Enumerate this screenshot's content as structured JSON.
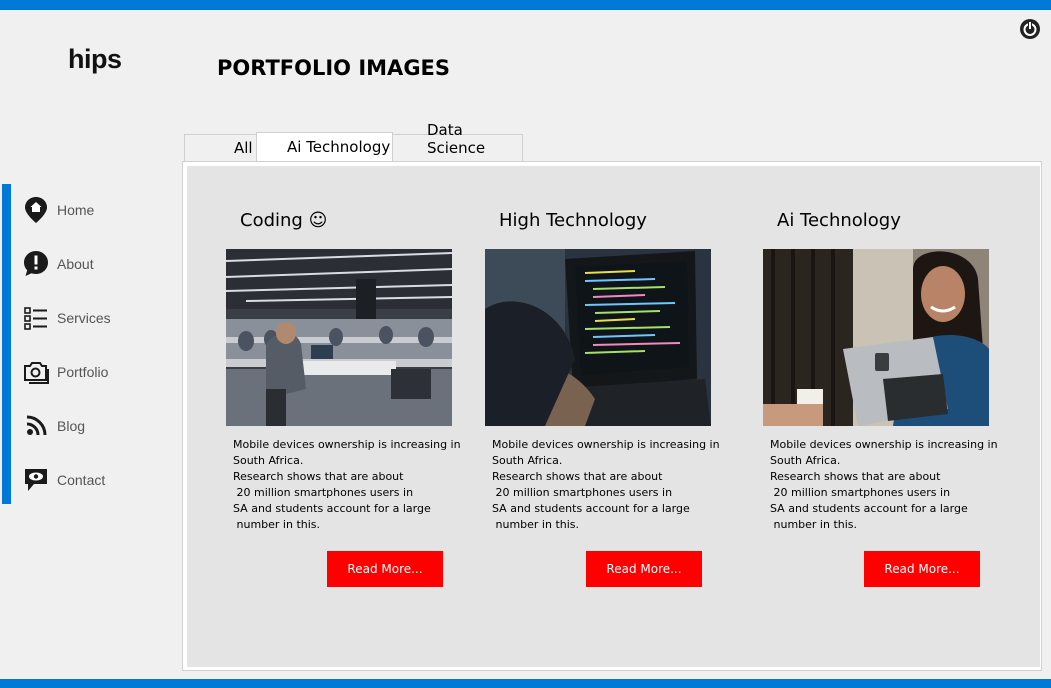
{
  "app": {
    "logo": "hips"
  },
  "header": {
    "title": "PORTFOLIO IMAGES"
  },
  "icons": {
    "power": "power-icon"
  },
  "sidebar": {
    "items": [
      {
        "label": "Home",
        "icon": "home-pin-icon"
      },
      {
        "label": "About",
        "icon": "info-alert-icon"
      },
      {
        "label": "Services",
        "icon": "list-icon"
      },
      {
        "label": "Portfolio",
        "icon": "camera-icon"
      },
      {
        "label": "Blog",
        "icon": "rss-icon"
      },
      {
        "label": "Contact",
        "icon": "chat-eye-icon"
      }
    ]
  },
  "tabs": [
    {
      "label": "All",
      "active": false
    },
    {
      "label": "Ai Technology",
      "active": true
    },
    {
      "label": "Data Science",
      "active": false
    }
  ],
  "cards": [
    {
      "title": "Coding ☺",
      "image": "office-workspace-photo",
      "text": "Mobile devices ownership is increasing in\nSouth Africa.\nResearch shows that are about\n 20 million smartphones users in\nSA and students account for a large\n number in this.",
      "button": "Read More..."
    },
    {
      "title": "High Technology",
      "image": "laptop-code-photo",
      "text": "Mobile devices ownership is increasing in\nSouth Africa.\nResearch shows that are about\n 20 million smartphones users in\nSA and students account for a large\n number in this.",
      "button": "Read More..."
    },
    {
      "title": "Ai Technology",
      "image": "woman-tablet-photo",
      "text": "Mobile devices ownership is increasing in\nSouth Africa.\nResearch shows that are about\n 20 million smartphones users in\nSA and students account for a large\n number in this.",
      "button": "Read More..."
    }
  ],
  "colors": {
    "accent": "#0078d7",
    "button": "#ff0000",
    "panel": "#e4e4e4",
    "background": "#f0f0f0"
  }
}
